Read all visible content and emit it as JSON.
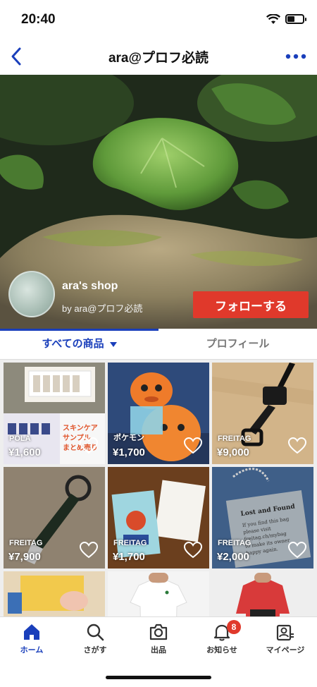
{
  "status": {
    "time": "20:40"
  },
  "nav": {
    "title": "ara@プロフ必読"
  },
  "shop": {
    "name": "ara's shop",
    "owner": "by ara@プロフ必読",
    "follow_label": "フォローする"
  },
  "tabs": {
    "all_label": "すべての商品",
    "profile_label": "プロフィール"
  },
  "items": [
    {
      "brand": "POLA",
      "price": "¥1,600",
      "overlay_text": "スキンケア\nサンプル\nまとめ売り"
    },
    {
      "brand": "ポケモン",
      "price": "¥1,700"
    },
    {
      "brand": "FREITAG",
      "price": "¥9,000"
    },
    {
      "brand": "FREITAG",
      "price": "¥7,900"
    },
    {
      "brand": "FREITAG",
      "price": "¥1,700"
    },
    {
      "brand": "FREITAG",
      "price": "¥2,000",
      "overlay_text": "Lost and Found\nIf you find this bag\nplease visit\nfreitag.ch/mybag\nto make its owner\nhappy again."
    },
    {
      "brand": "",
      "price": ""
    },
    {
      "brand": "",
      "price": ""
    },
    {
      "brand": "",
      "price": ""
    }
  ],
  "tabbar": {
    "home": "ホーム",
    "search": "さがす",
    "sell": "出品",
    "notifications": "お知らせ",
    "notifications_badge": "8",
    "mypage": "マイページ"
  },
  "colors": {
    "accent": "#1a3fbb",
    "follow": "#e0392b",
    "badge": "#e0392b"
  }
}
